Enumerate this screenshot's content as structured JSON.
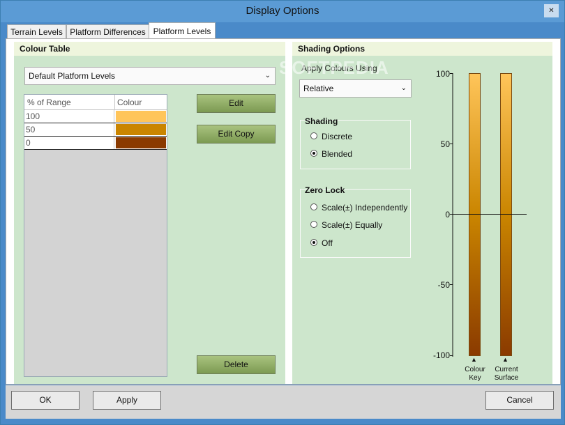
{
  "window": {
    "title": "Display Options",
    "close_glyph": "✕"
  },
  "tabs": [
    {
      "label": "Terrain Levels",
      "active": false
    },
    {
      "label": "Platform Differences",
      "active": false
    },
    {
      "label": "Platform Levels",
      "active": true
    }
  ],
  "colour_table": {
    "header": "Colour Table",
    "selected": "Default Platform Levels",
    "columns": [
      "% of Range",
      "Colour"
    ],
    "rows": [
      {
        "pct": "100",
        "color": "#ffc55a"
      },
      {
        "pct": "50",
        "color": "#ca8500"
      },
      {
        "pct": "0",
        "color": "#8a3a00"
      }
    ],
    "edit_label": "Edit",
    "edit_copy_label": "Edit Copy",
    "delete_label": "Delete"
  },
  "shading_options": {
    "header": "Shading Options",
    "apply_label": "Apply Colours Using",
    "apply_value": "Relative",
    "shading": {
      "title": "Shading",
      "options": [
        {
          "label": "Discrete",
          "checked": false
        },
        {
          "label": "Blended",
          "checked": true
        }
      ]
    },
    "zero_lock": {
      "title": "Zero Lock",
      "options": [
        {
          "label": "Scale(±) Independently",
          "checked": false
        },
        {
          "label": "Scale(±) Equally",
          "checked": false
        },
        {
          "label": "Off",
          "checked": true
        }
      ]
    },
    "scale_ticks": [
      "100",
      "50",
      "0",
      "-50",
      "-100"
    ],
    "bar1_label_line1": "Colour",
    "bar1_label_line2": "Key",
    "bar2_label_line1": "Current",
    "bar2_label_line2": "Surface",
    "marker_glyph": "▲"
  },
  "watermark": "SOFTPEDIA",
  "buttons": {
    "ok": "OK",
    "apply": "Apply",
    "cancel": "Cancel"
  }
}
